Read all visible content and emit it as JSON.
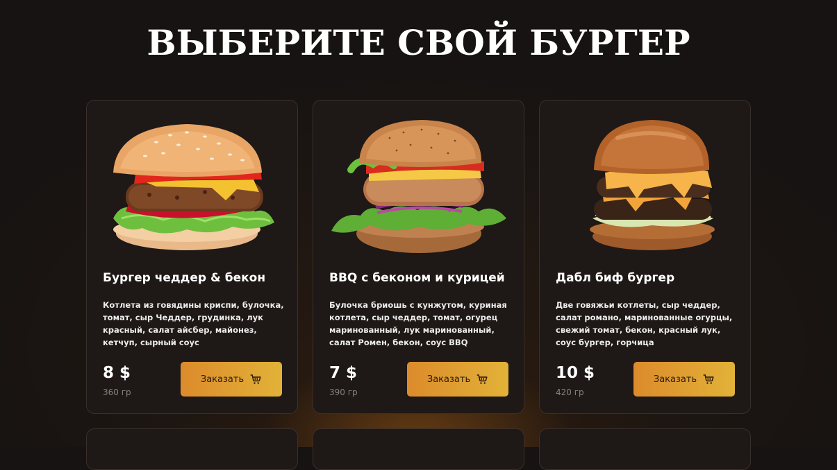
{
  "page_title": "ВЫБЕРИТЕ СВОЙ БУРГЕР",
  "colors": {
    "background": "#161312",
    "card": "#1e1816",
    "accent_start": "#dc8b2b",
    "accent_end": "#e2b238"
  },
  "cards": [
    {
      "name": "Бургер чеддер & бекон",
      "description": "Котлета из говядины криспи, булочка, томат, сыр Чеддер, грудинка, лук красный, салат айсбер, майонез, кетчуп, сырный соус",
      "price": "8 $",
      "weight": "360 гр",
      "button_label": "Заказать",
      "button_icon": "cart-icon"
    },
    {
      "name": "BBQ с беконом и курицей",
      "description": "Булочка бриошь с кунжутом, куриная котлета, сыр чеддер, томат, огурец маринованный, лук маринованный, салат Ромен, бекон, соус BBQ",
      "price": "7 $",
      "weight": "390 гр",
      "button_label": "Заказать",
      "button_icon": "cart-icon"
    },
    {
      "name": "Дабл биф бургер",
      "description": "Две говяжьи котлеты, сыр чеддер, салат романо, маринованные огурцы, свежий томат, бекон, красный лук, соус бургер, горчица",
      "price": "10 $",
      "weight": "420 гр",
      "button_label": "Заказать",
      "button_icon": "cart-icon"
    }
  ]
}
